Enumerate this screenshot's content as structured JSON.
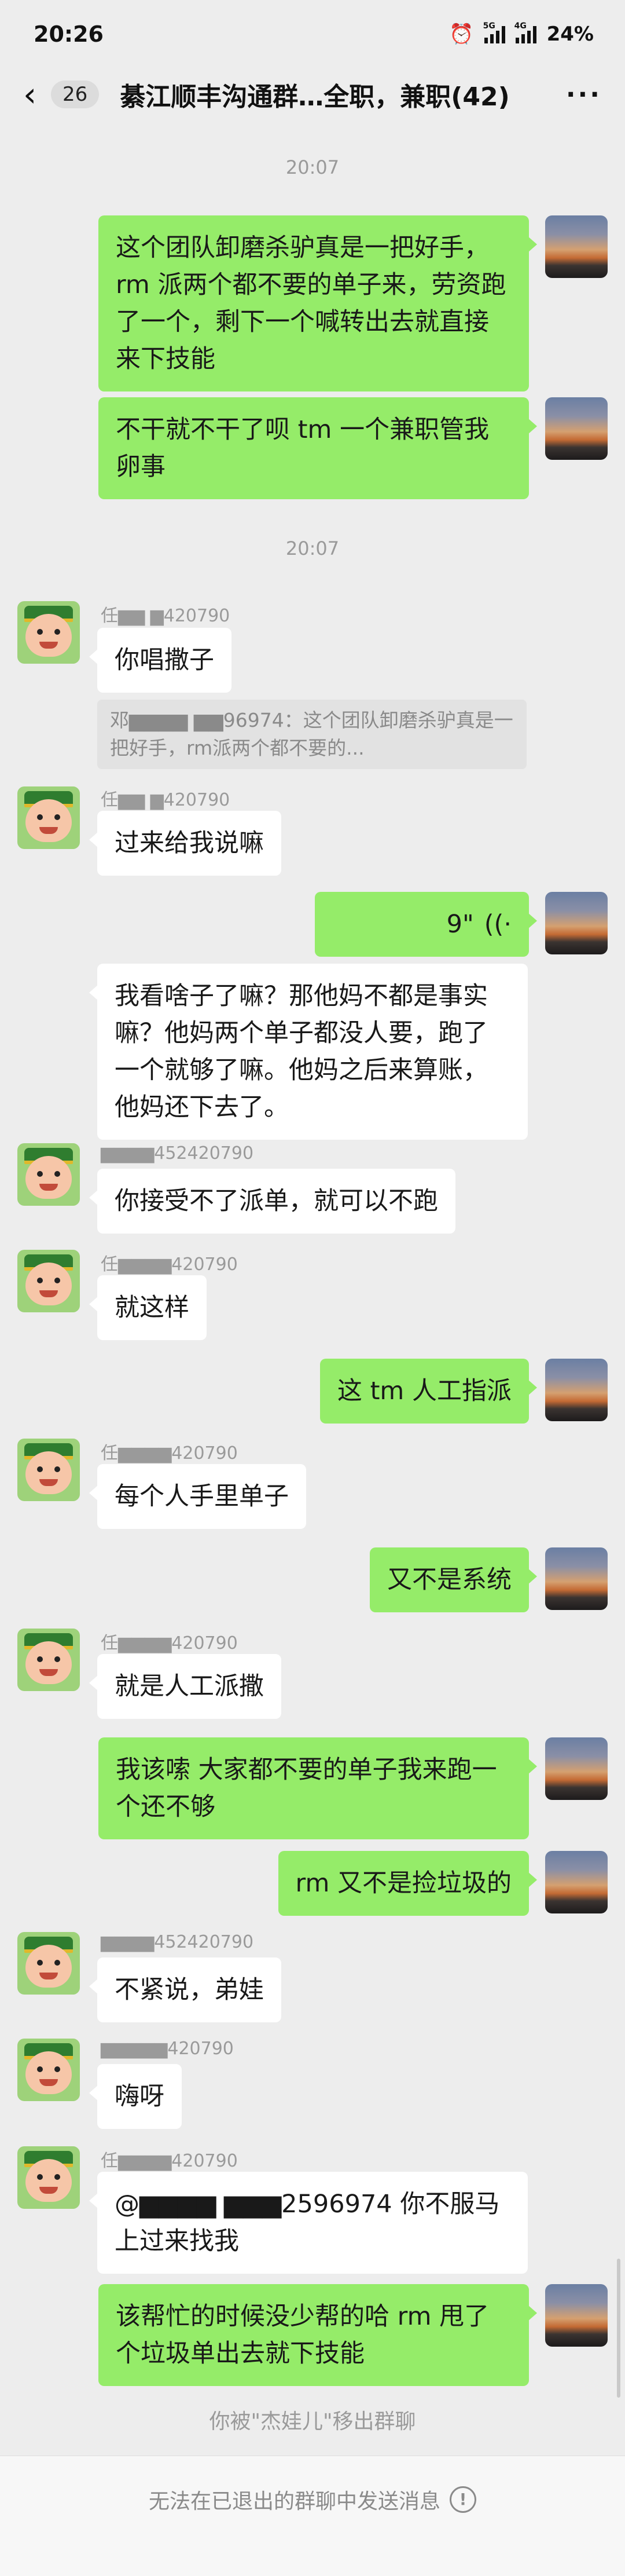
{
  "status": {
    "time": "20:26",
    "net1": "5G",
    "net2": "4G",
    "battery": "24%"
  },
  "header": {
    "unread": "26",
    "title": "綦江顺丰沟通群…全职，兼职(42)",
    "more": "···"
  },
  "messages": {
    "t1": "20:07",
    "o1": "这个团队卸磨杀驴真是一把好手，rm 派两个都不要的单子来，劳资跑了一个，剩下一个喊转出去就直接来下技能",
    "o2": "不干就不干了呗 tm 一个兼职管我卵事",
    "t2": "20:07",
    "n1": "任▆▆ ▆420790",
    "i1": "你唱撒子",
    "q1": "邓▆▆▆▆ ▆▆96974：这个团队卸磨杀驴真是一把好手，rm派两个都不要的...",
    "n2": "任▆▆ ▆420790",
    "i2": "过来给我说嘛",
    "v1": "9\"",
    "i3": "我看啥子了嘛？那他妈不都是事实嘛？他妈两个单子都没人要，跑了一个就够了嘛。他妈之后来算账，他妈还下去了。",
    "n3": "▆▆▆▆452420790",
    "i4": "你接受不了派单，就可以不跑",
    "n4": "任▆▆▆▆420790",
    "i5": "就这样",
    "o3": "这 tm 人工指派",
    "n5": "任▆▆▆▆420790",
    "i6": "每个人手里单子",
    "o4": "又不是系统",
    "n6": "任▆▆▆▆420790",
    "i7": "就是人工派撒",
    "o5": "我该嗦 大家都不要的单子我来跑一个还不够",
    "o6": "rm 又不是捡垃圾的",
    "n7": "▆▆▆▆452420790",
    "i8": "不紧说，弟娃",
    "n8": "▆▆▆▆▆420790",
    "i9": "嗨呀",
    "n9": "任▆▆▆▆420790",
    "i10": "@▆▆▆▆ ▆▆▆2596974 你不服马上过来找我",
    "o7": "该帮忙的时候没少帮的哈 rm 甩了个垃圾单出去就下技能",
    "sys1": "你被\"杰娃儿\"移出群聊"
  },
  "footer": {
    "text": "无法在已退出的群聊中发送消息",
    "icon": "!"
  }
}
